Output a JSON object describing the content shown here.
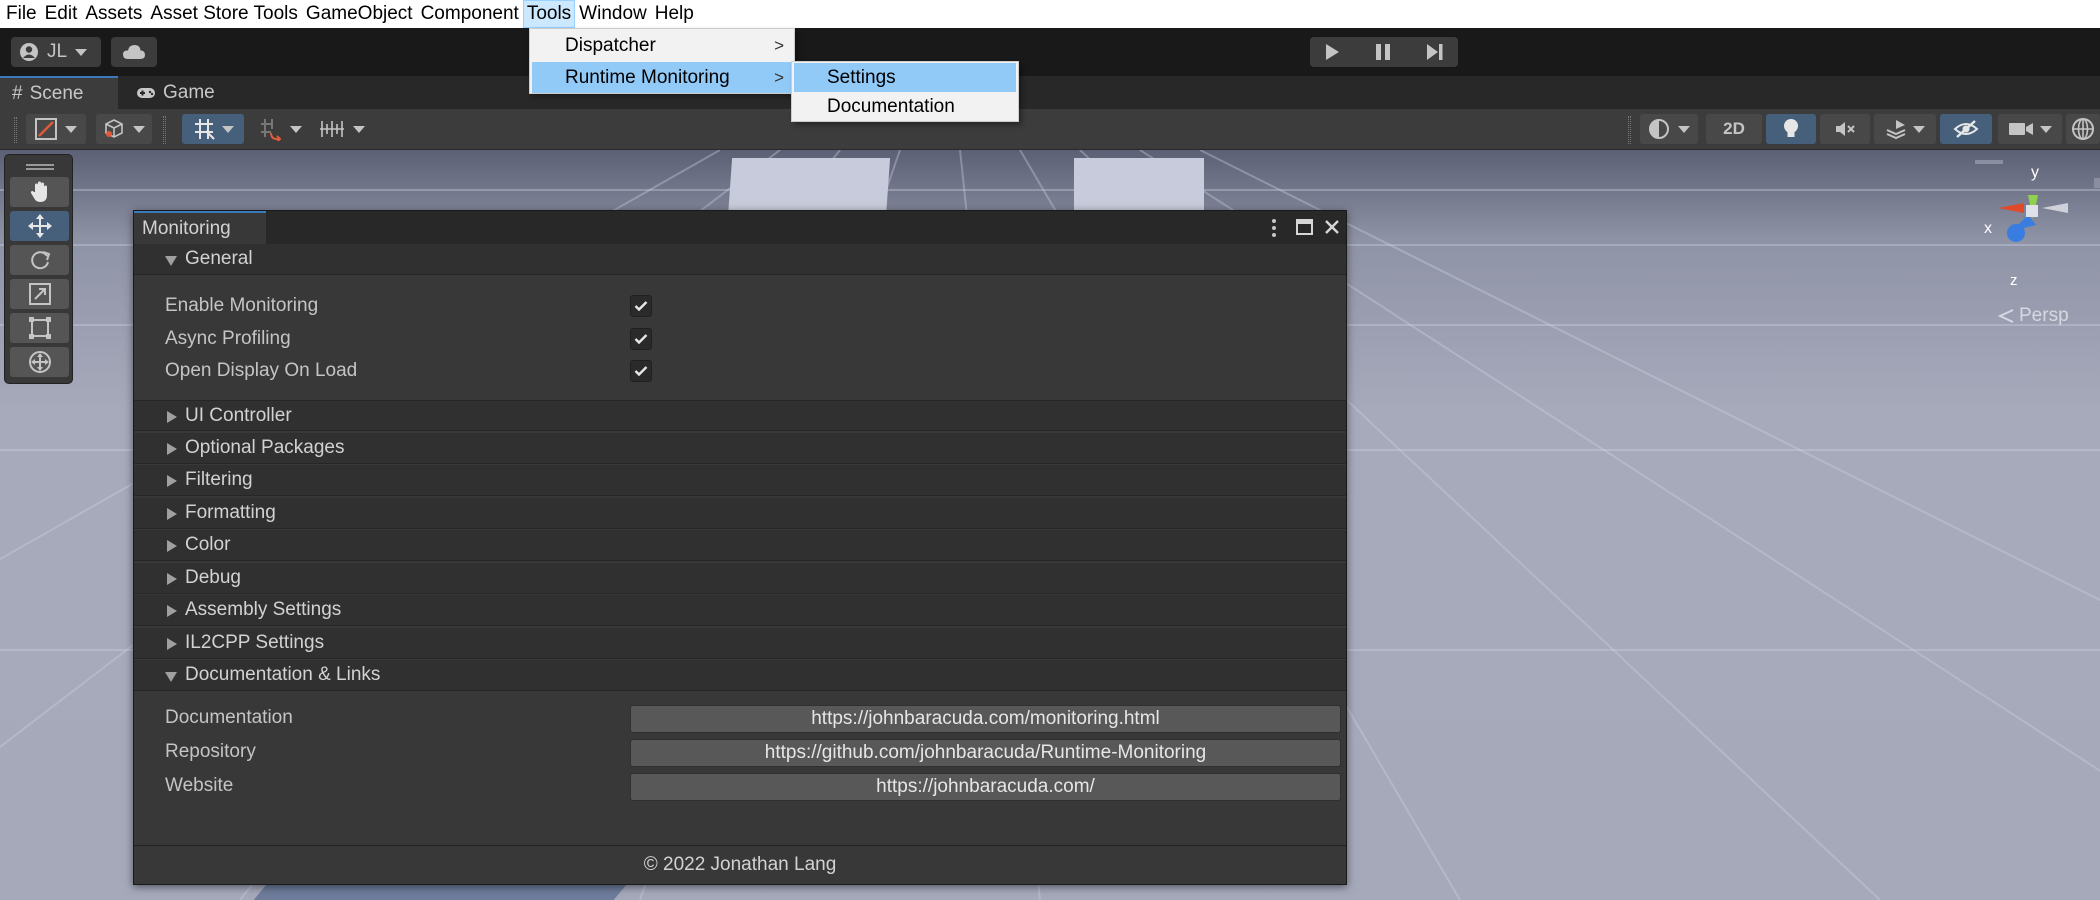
{
  "menubar": {
    "items": [
      "File",
      "Edit",
      "Assets",
      "Asset Store Tools",
      "GameObject",
      "Component",
      "Tools",
      "Window",
      "Help"
    ]
  },
  "toolbar": {
    "account_label": "JL"
  },
  "tabs": [
    {
      "label": "Scene"
    },
    {
      "label": "Game"
    }
  ],
  "scenebar": {
    "mode_2d_label": "2D"
  },
  "gizmo": {
    "y_label": "y",
    "x_label": "x",
    "z_label": "z",
    "persp_label": "Persp"
  },
  "tools_menu": {
    "items": [
      {
        "label": "Dispatcher",
        "has_submenu": true
      },
      {
        "label": "Runtime Monitoring",
        "has_submenu": true
      }
    ],
    "submenu_arrow": ">"
  },
  "runtime_submenu": {
    "items": [
      {
        "label": "Settings"
      },
      {
        "label": "Documentation"
      }
    ]
  },
  "monitor": {
    "title": "Monitoring",
    "general_header": "General",
    "toggles": [
      {
        "label": "Enable Monitoring",
        "checked": true
      },
      {
        "label": "Async Profiling",
        "checked": true
      },
      {
        "label": "Open Display On Load",
        "checked": true
      }
    ],
    "sections": [
      {
        "label": "UI Controller"
      },
      {
        "label": "Optional Packages"
      },
      {
        "label": "Filtering"
      },
      {
        "label": "Formatting"
      },
      {
        "label": "Color"
      },
      {
        "label": "Debug"
      },
      {
        "label": "Assembly Settings"
      },
      {
        "label": "IL2CPP Settings"
      }
    ],
    "docs_header": "Documentation & Links",
    "links": [
      {
        "label": "Documentation",
        "url": "https://johnbaracuda.com/monitoring.html"
      },
      {
        "label": "Repository",
        "url": "https://github.com/johnbaracuda/Runtime-Monitoring"
      },
      {
        "label": "Website",
        "url": "https://johnbaracuda.com/"
      }
    ],
    "footer": "© 2022 Jonathan Lang"
  },
  "colors": {
    "accent": "#3a79bb",
    "menu_highlight": "#91c9f7",
    "panel_bg": "#383838"
  }
}
